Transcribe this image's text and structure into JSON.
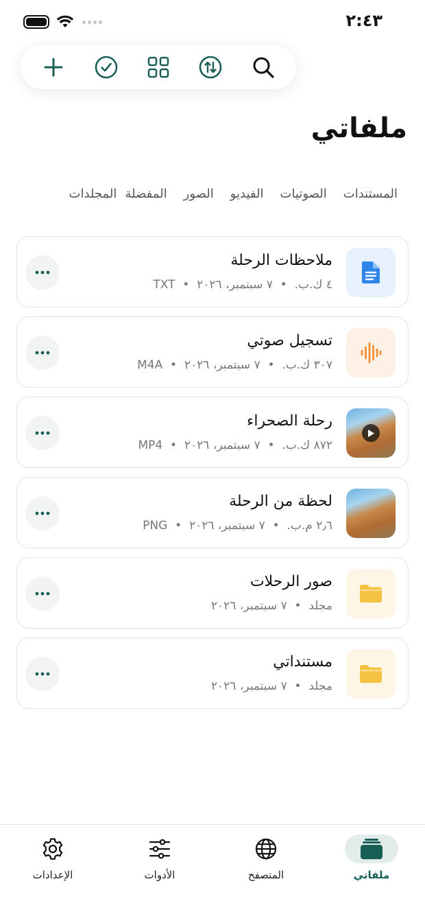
{
  "status_bar": {
    "time": "٢:٤٣"
  },
  "toolbar": {
    "icons": [
      "plus-icon",
      "check-circle-icon",
      "grid-icon",
      "sort-icon",
      "search-icon"
    ]
  },
  "page": {
    "title": "ملفاتي"
  },
  "tabs": [
    {
      "label": "المجلدات"
    },
    {
      "label": "المفضلة"
    },
    {
      "label": "الصور"
    },
    {
      "label": "الفيديو"
    },
    {
      "label": "الصوتيات"
    },
    {
      "label": "المستندات"
    }
  ],
  "files": [
    {
      "name": "ملاحظات الرحلة",
      "size": "٤ ك.ب.",
      "date": "٧ سبتمبر، ٢٠٢٦",
      "type": "TXT",
      "icon": "document-icon"
    },
    {
      "name": "تسجيل صوتي",
      "size": "٣٠٧ ك.ب.",
      "date": "٧ سبتمبر، ٢٠٢٦",
      "type": "M4A",
      "icon": "audio-wave-icon"
    },
    {
      "name": "رحلة الصحراء",
      "size": "٨٧٢ ك.ب.",
      "date": "٧ سبتمبر، ٢٠٢٦",
      "type": "MP4",
      "icon": "video-thumbnail"
    },
    {
      "name": "لحظة من الرحلة",
      "size": "٢٫٦ م.ب.",
      "date": "٧ سبتمبر، ٢٠٢٦",
      "type": "PNG",
      "icon": "image-thumbnail"
    },
    {
      "name": "صور الرحلات",
      "size": "مجلد",
      "date": "٧ سبتمبر، ٢٠٢٦",
      "type": "",
      "icon": "folder-icon"
    },
    {
      "name": "مستنداتي",
      "size": "مجلد",
      "date": "٧ سبتمبر، ٢٠٢٦",
      "type": "",
      "icon": "folder-icon"
    }
  ],
  "bottom_nav": [
    {
      "label": "ملفاتي",
      "icon": "files-stack-icon",
      "active": true
    },
    {
      "label": "المتصفح",
      "icon": "globe-icon",
      "active": false
    },
    {
      "label": "الأدوات",
      "icon": "sliders-icon",
      "active": false
    },
    {
      "label": "الإعدادات",
      "icon": "gear-icon",
      "active": false
    }
  ],
  "colors": {
    "accent": "#1a5f56",
    "doc_blue": "#2e86ea",
    "audio_orange": "#f0892d",
    "folder_yellow": "#f5c242"
  }
}
